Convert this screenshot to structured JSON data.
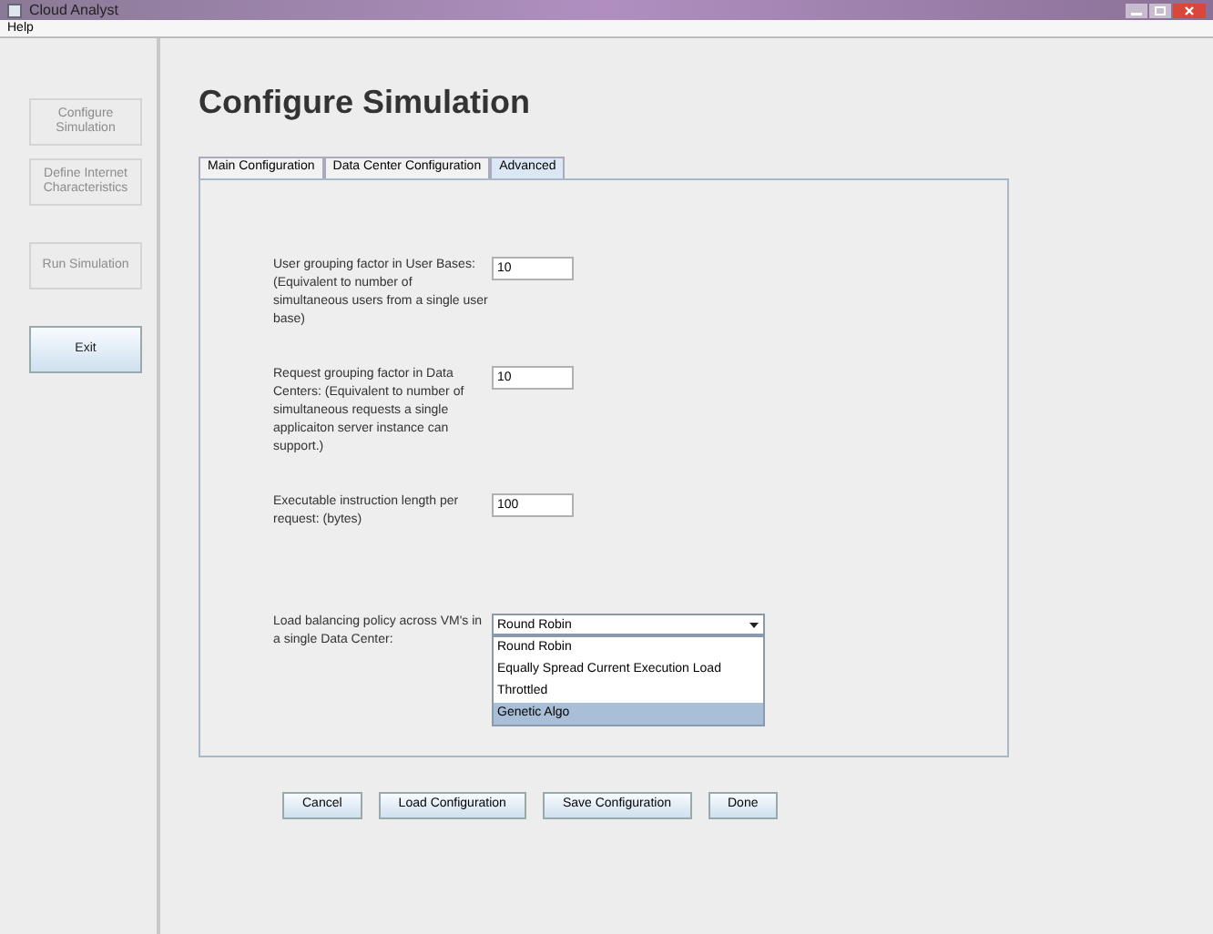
{
  "window": {
    "title": "Cloud Analyst"
  },
  "menu": [
    "Help"
  ],
  "sidebar": [
    {
      "label": "Configure Simulation",
      "disabled": true
    },
    {
      "label": "Define Internet Characteristics",
      "disabled": true
    },
    {
      "label": "Run Simulation",
      "disabled": true
    },
    {
      "label": "Exit",
      "disabled": false
    }
  ],
  "heading": "Configure Simulation",
  "tabs": [
    {
      "label": "Main Configuration",
      "selected": false
    },
    {
      "label": "Data Center Configuration",
      "selected": false
    },
    {
      "label": "Advanced",
      "selected": true
    }
  ],
  "fields": [
    {
      "label": "User grouping factor in User Bases: (Equivalent to number of simultaneous users from a single user base)",
      "value": "10"
    },
    {
      "label": "Request grouping factor in Data Centers: (Equivalent to number of simultaneous requests a single applicaiton server instance can support.)",
      "value": "10"
    },
    {
      "label": "Executable instruction length per request: (bytes)",
      "value": "100"
    }
  ],
  "policy": {
    "label": "Load balancing policy across VM's in a single Data Center:",
    "value": "Round Robin",
    "options": [
      {
        "label": "Round Robin",
        "highlighted": false
      },
      {
        "label": "Equally Spread Current Execution Load",
        "highlighted": false
      },
      {
        "label": "Throttled",
        "highlighted": false
      },
      {
        "label": "Genetic Algo",
        "highlighted": true
      }
    ]
  },
  "buttons": [
    "Cancel",
    "Load Configuration",
    "Save Configuration",
    "Done"
  ]
}
